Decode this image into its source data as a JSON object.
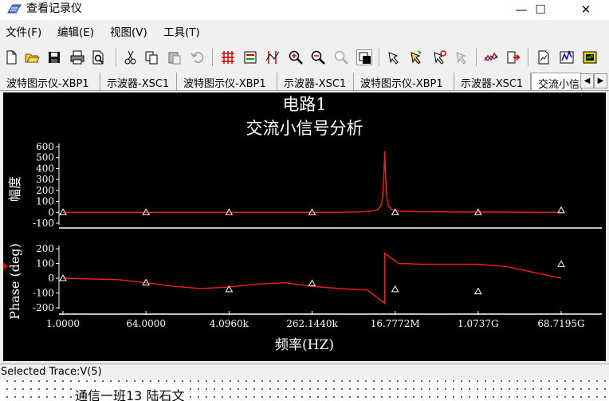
{
  "window": {
    "title": "查看记录仪",
    "min_glyph": "—",
    "max_glyph": "☐",
    "close_glyph": "✕"
  },
  "menu": [
    "文件(F)",
    "编辑(E)",
    "视图(V)",
    "工具(T)"
  ],
  "toolbar_icons": [
    "new-icon",
    "open-icon",
    "save-icon",
    "print-icon",
    "print-preview-icon",
    "cut-icon",
    "copy-icon",
    "paste-icon",
    "undo-icon",
    "grid-icon",
    "legend-icon",
    "cursors-icon",
    "zoom-in-icon",
    "zoom-out-icon",
    "zoom-full-icon",
    "reverse-colors-icon",
    "select-marker-icon",
    "marker-add-icon",
    "marker-refresh-icon",
    "marker-remove-icon",
    "trace-icon",
    "export-icon",
    "export-data-icon",
    "graph-properties-icon",
    "labview-icon"
  ],
  "tabs": [
    "波特图示仪-XBP1",
    "示波器-XSC1",
    "波特图示仪-XBP1",
    "示波器-XSC1",
    "波特图示仪-XBP1",
    "示波器-XSC1",
    "交流小信"
  ],
  "plot": {
    "title_line1": "电路1",
    "title_line2": "交流小信号分析",
    "bg_color": "#000000",
    "trace_color": "#ff1a1a",
    "axis_color": "#ffffff"
  },
  "chart_data": [
    {
      "type": "line",
      "ylabel": "幅度",
      "ylim": [
        -100,
        600
      ],
      "yticks": [
        "600",
        "500",
        "400",
        "300",
        "200",
        "100",
        "0",
        "-100"
      ],
      "x_scale": "log",
      "series": [
        {
          "x": [
            1,
            10,
            100,
            1000,
            10000,
            100000,
            1000000,
            3000000,
            5000000,
            7000000,
            8000000,
            8500000,
            9000000,
            9500000,
            10000000,
            10500000,
            11000000,
            12000000,
            14000000,
            20000000,
            50000000,
            1000000000,
            68719500000
          ],
          "y": [
            0,
            0,
            0,
            0,
            0,
            0,
            0,
            4,
            10,
            25,
            50,
            80,
            150,
            300,
            560,
            300,
            150,
            60,
            25,
            10,
            5,
            2,
            0
          ]
        }
      ],
      "markers_x": [
        1,
        64,
        4096,
        262144,
        16777216,
        1073741824,
        68719476736,
        4398046511104,
        281474976710656,
        18014398509481984
      ],
      "markers_y": [
        0,
        0,
        0,
        0,
        0,
        0,
        18,
        0,
        0,
        0
      ]
    },
    {
      "type": "line",
      "ylabel": "Phase (deg)",
      "ylim": [
        -200,
        200
      ],
      "yticks": [
        "200",
        "100",
        "0",
        "-100",
        "-200"
      ],
      "xlabel": "频率(HZ)",
      "xticks": [
        "1.0000",
        "64.0000",
        "4.0960k",
        "262.1440k",
        "16.7772M",
        "1.0737G",
        "68.7195G"
      ],
      "x_scale": "log",
      "series": [
        {
          "x": [
            1,
            16,
            64,
            256,
            1024,
            4096,
            16384,
            65536,
            262144,
            1048576,
            4194304,
            10000000,
            10000001,
            20000000,
            67108864,
            268435456,
            1073741824,
            4294967296,
            17179869184,
            68719476736
          ],
          "y": [
            0,
            -10,
            -30,
            -55,
            -70,
            -60,
            -40,
            -30,
            -55,
            -70,
            -80,
            -170,
            170,
            100,
            95,
            95,
            95,
            80,
            40,
            0
          ]
        }
      ],
      "markers_x": [
        1,
        64,
        4096,
        262144,
        16777216,
        1073741824,
        68719476736,
        4398046511104,
        281474976710656,
        18014398509481984
      ],
      "markers_y": [
        0,
        -30,
        -75,
        -35,
        -75,
        -90,
        95,
        90,
        28,
        0
      ]
    }
  ],
  "status": {
    "selected_trace": "Selected Trace:V(5)"
  },
  "bottom": {
    "text": "通信一班13 陆石文"
  }
}
